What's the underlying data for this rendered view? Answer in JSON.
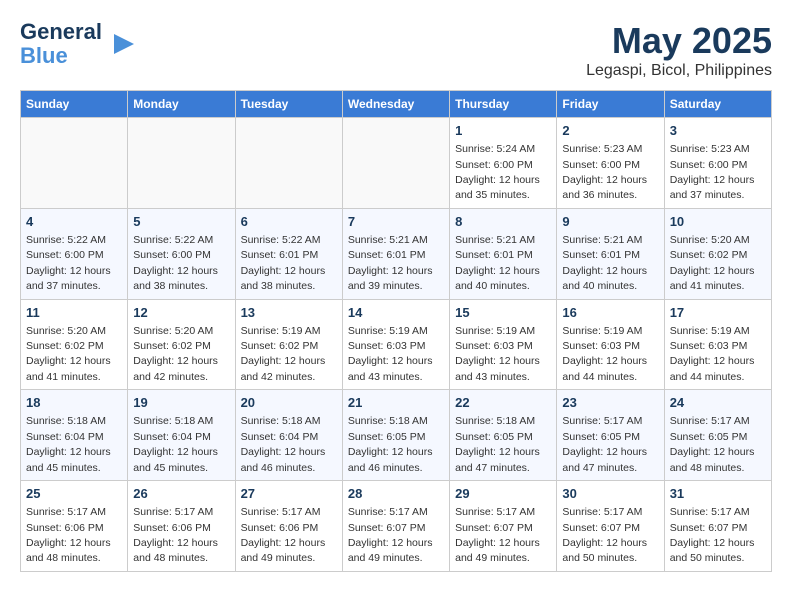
{
  "header": {
    "logo_line1": "General",
    "logo_line2": "Blue",
    "month": "May 2025",
    "location": "Legaspi, Bicol, Philippines"
  },
  "weekdays": [
    "Sunday",
    "Monday",
    "Tuesday",
    "Wednesday",
    "Thursday",
    "Friday",
    "Saturday"
  ],
  "weeks": [
    [
      {
        "day": "",
        "info": ""
      },
      {
        "day": "",
        "info": ""
      },
      {
        "day": "",
        "info": ""
      },
      {
        "day": "",
        "info": ""
      },
      {
        "day": "1",
        "info": "Sunrise: 5:24 AM\nSunset: 6:00 PM\nDaylight: 12 hours\nand 35 minutes."
      },
      {
        "day": "2",
        "info": "Sunrise: 5:23 AM\nSunset: 6:00 PM\nDaylight: 12 hours\nand 36 minutes."
      },
      {
        "day": "3",
        "info": "Sunrise: 5:23 AM\nSunset: 6:00 PM\nDaylight: 12 hours\nand 37 minutes."
      }
    ],
    [
      {
        "day": "4",
        "info": "Sunrise: 5:22 AM\nSunset: 6:00 PM\nDaylight: 12 hours\nand 37 minutes."
      },
      {
        "day": "5",
        "info": "Sunrise: 5:22 AM\nSunset: 6:00 PM\nDaylight: 12 hours\nand 38 minutes."
      },
      {
        "day": "6",
        "info": "Sunrise: 5:22 AM\nSunset: 6:01 PM\nDaylight: 12 hours\nand 38 minutes."
      },
      {
        "day": "7",
        "info": "Sunrise: 5:21 AM\nSunset: 6:01 PM\nDaylight: 12 hours\nand 39 minutes."
      },
      {
        "day": "8",
        "info": "Sunrise: 5:21 AM\nSunset: 6:01 PM\nDaylight: 12 hours\nand 40 minutes."
      },
      {
        "day": "9",
        "info": "Sunrise: 5:21 AM\nSunset: 6:01 PM\nDaylight: 12 hours\nand 40 minutes."
      },
      {
        "day": "10",
        "info": "Sunrise: 5:20 AM\nSunset: 6:02 PM\nDaylight: 12 hours\nand 41 minutes."
      }
    ],
    [
      {
        "day": "11",
        "info": "Sunrise: 5:20 AM\nSunset: 6:02 PM\nDaylight: 12 hours\nand 41 minutes."
      },
      {
        "day": "12",
        "info": "Sunrise: 5:20 AM\nSunset: 6:02 PM\nDaylight: 12 hours\nand 42 minutes."
      },
      {
        "day": "13",
        "info": "Sunrise: 5:19 AM\nSunset: 6:02 PM\nDaylight: 12 hours\nand 42 minutes."
      },
      {
        "day": "14",
        "info": "Sunrise: 5:19 AM\nSunset: 6:03 PM\nDaylight: 12 hours\nand 43 minutes."
      },
      {
        "day": "15",
        "info": "Sunrise: 5:19 AM\nSunset: 6:03 PM\nDaylight: 12 hours\nand 43 minutes."
      },
      {
        "day": "16",
        "info": "Sunrise: 5:19 AM\nSunset: 6:03 PM\nDaylight: 12 hours\nand 44 minutes."
      },
      {
        "day": "17",
        "info": "Sunrise: 5:19 AM\nSunset: 6:03 PM\nDaylight: 12 hours\nand 44 minutes."
      }
    ],
    [
      {
        "day": "18",
        "info": "Sunrise: 5:18 AM\nSunset: 6:04 PM\nDaylight: 12 hours\nand 45 minutes."
      },
      {
        "day": "19",
        "info": "Sunrise: 5:18 AM\nSunset: 6:04 PM\nDaylight: 12 hours\nand 45 minutes."
      },
      {
        "day": "20",
        "info": "Sunrise: 5:18 AM\nSunset: 6:04 PM\nDaylight: 12 hours\nand 46 minutes."
      },
      {
        "day": "21",
        "info": "Sunrise: 5:18 AM\nSunset: 6:05 PM\nDaylight: 12 hours\nand 46 minutes."
      },
      {
        "day": "22",
        "info": "Sunrise: 5:18 AM\nSunset: 6:05 PM\nDaylight: 12 hours\nand 47 minutes."
      },
      {
        "day": "23",
        "info": "Sunrise: 5:17 AM\nSunset: 6:05 PM\nDaylight: 12 hours\nand 47 minutes."
      },
      {
        "day": "24",
        "info": "Sunrise: 5:17 AM\nSunset: 6:05 PM\nDaylight: 12 hours\nand 48 minutes."
      }
    ],
    [
      {
        "day": "25",
        "info": "Sunrise: 5:17 AM\nSunset: 6:06 PM\nDaylight: 12 hours\nand 48 minutes."
      },
      {
        "day": "26",
        "info": "Sunrise: 5:17 AM\nSunset: 6:06 PM\nDaylight: 12 hours\nand 48 minutes."
      },
      {
        "day": "27",
        "info": "Sunrise: 5:17 AM\nSunset: 6:06 PM\nDaylight: 12 hours\nand 49 minutes."
      },
      {
        "day": "28",
        "info": "Sunrise: 5:17 AM\nSunset: 6:07 PM\nDaylight: 12 hours\nand 49 minutes."
      },
      {
        "day": "29",
        "info": "Sunrise: 5:17 AM\nSunset: 6:07 PM\nDaylight: 12 hours\nand 49 minutes."
      },
      {
        "day": "30",
        "info": "Sunrise: 5:17 AM\nSunset: 6:07 PM\nDaylight: 12 hours\nand 50 minutes."
      },
      {
        "day": "31",
        "info": "Sunrise: 5:17 AM\nSunset: 6:07 PM\nDaylight: 12 hours\nand 50 minutes."
      }
    ]
  ]
}
